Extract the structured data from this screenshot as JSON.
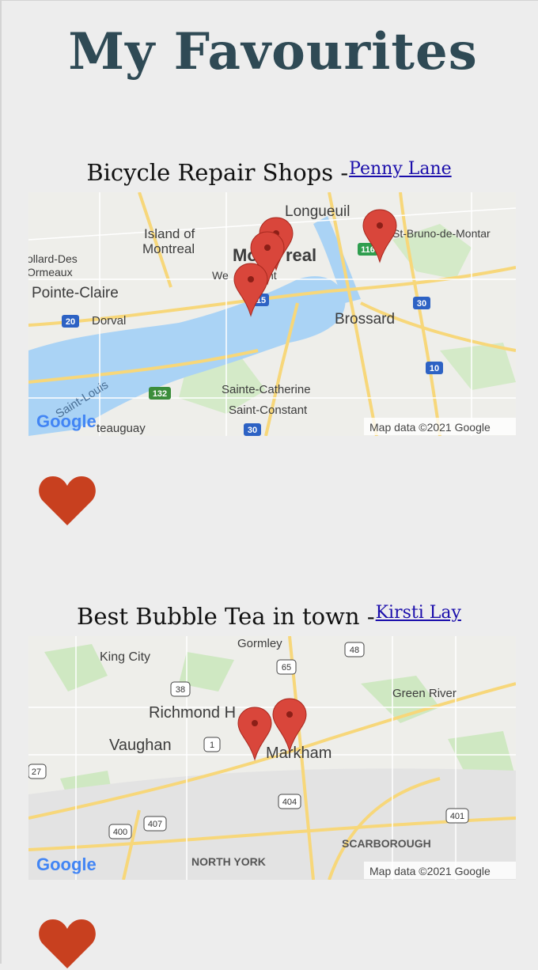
{
  "page": {
    "title": "My Favourites"
  },
  "favourites": [
    {
      "name": "Bicycle Repair Shops",
      "separator": "-",
      "author": "Penny Lane",
      "map": {
        "attribution": "Map data ©2021 Google",
        "logo": "Google",
        "labels": [
          "Longueuil",
          "Island of",
          "Montreal",
          "Mo",
          "real",
          "We",
          "nt",
          "St-Bruno-de-Montar",
          "ollard-Des",
          "Ormeaux",
          "Pointe-Claire",
          "Dorval",
          "Brossard",
          "Saint-Louis",
          "Sainte-Catherine",
          "Saint-Constant",
          "teauguay"
        ],
        "shields": [
          "116",
          "15",
          "20",
          "30",
          "10",
          "132",
          "30"
        ]
      },
      "favourite_icon": "heart-icon"
    },
    {
      "name": "Best Bubble Tea in town",
      "separator": "-",
      "author": "Kirsti Lay",
      "map": {
        "attribution": "Map data ©2021 Google",
        "logo": "Google",
        "labels": [
          "Gormley",
          "King City",
          "Green River",
          "Richmond H",
          "Vaughan",
          "Markham",
          "SCARBOROUGH",
          "NORTH YORK"
        ],
        "shields": [
          "48",
          "65",
          "38",
          "1",
          "27",
          "404",
          "401",
          "407",
          "400"
        ]
      },
      "favourite_icon": "heart-icon"
    }
  ],
  "colors": {
    "title": "#2f4a55",
    "heart": "#c8401f",
    "pin": "#d9463b",
    "water": "#aad3f5",
    "park": "#cce8c0",
    "road_major": "#f7d77a"
  }
}
